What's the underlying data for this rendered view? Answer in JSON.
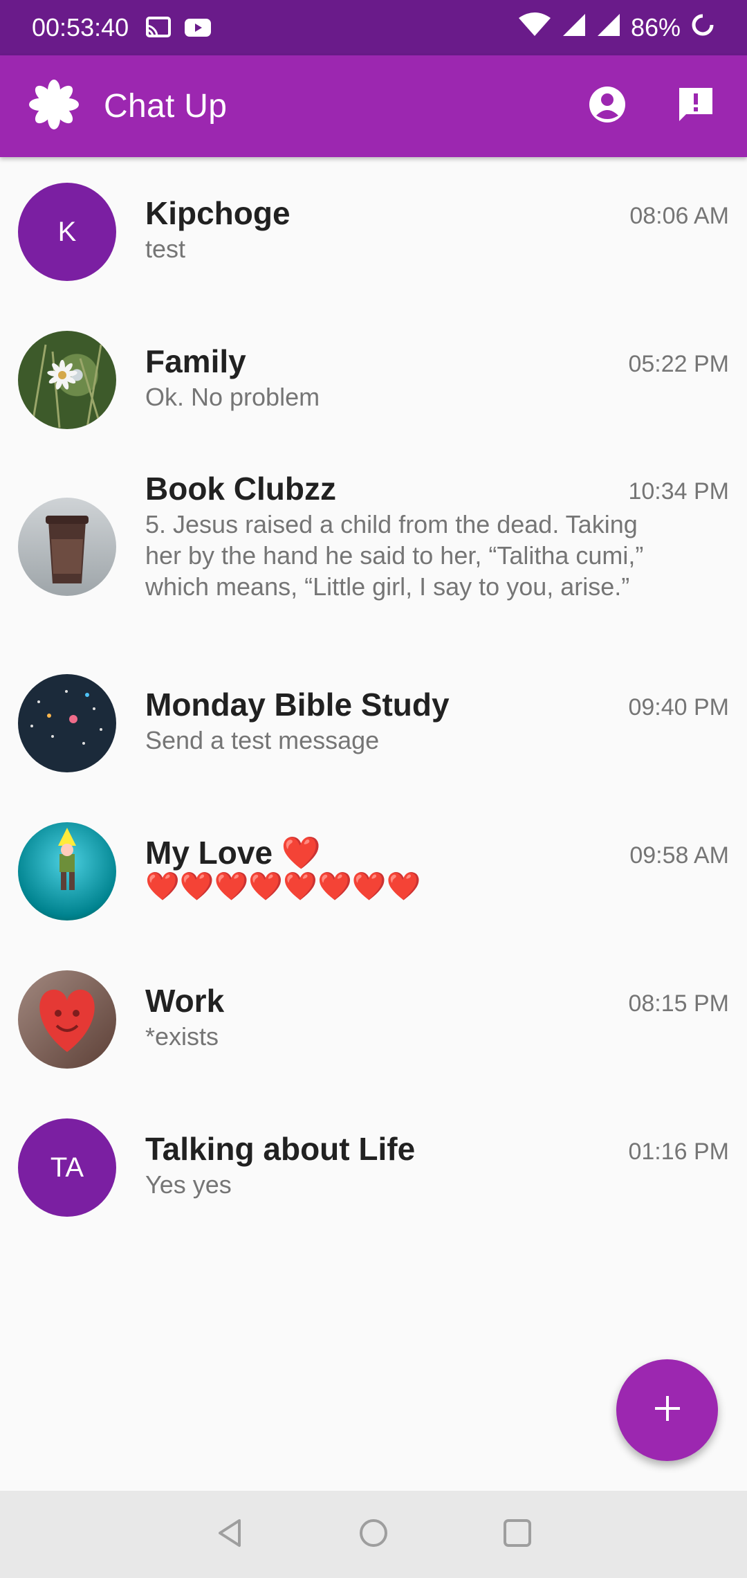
{
  "status_bar": {
    "time": "00:53:40",
    "battery": "86%",
    "icons": [
      "cast-icon",
      "youtube-icon",
      "wifi-icon",
      "signal-icon",
      "signal-icon",
      "battery-icon"
    ]
  },
  "app_bar": {
    "title": "Chat Up",
    "logo_icon": "asterisk-logo-icon",
    "actions": [
      "account-circle-icon",
      "feedback-icon"
    ],
    "color": "#9c27b0"
  },
  "chats": [
    {
      "name": "Kipchoge",
      "time": "08:06 AM",
      "preview": "test",
      "avatar_initials": "K"
    },
    {
      "name": "Family",
      "time": "05:22 PM",
      "preview": "Ok. No problem"
    },
    {
      "name": "Book Clubzz",
      "time": "10:34 PM",
      "preview": "5. Jesus raised a child from the dead. Taking her by the hand he said to her, “Talitha cumi,” which means, “Little girl, I say to you, arise.”"
    },
    {
      "name": "Monday Bible Study",
      "time": "09:40 PM",
      "preview": "Send a test message"
    },
    {
      "name": "My Love ❤️",
      "time": "09:58 AM",
      "preview": "❤️❤️❤️❤️❤️❤️❤️❤️"
    },
    {
      "name": "Work",
      "time": "08:15 PM",
      "preview": "*exists"
    },
    {
      "name": "Talking about Life",
      "time": "01:16 PM",
      "preview": "Yes yes",
      "avatar_initials": "TA"
    }
  ],
  "fab": {
    "icon": "plus-icon"
  },
  "nav_bar": {
    "icons": [
      "back-icon",
      "home-icon",
      "recents-icon"
    ]
  }
}
